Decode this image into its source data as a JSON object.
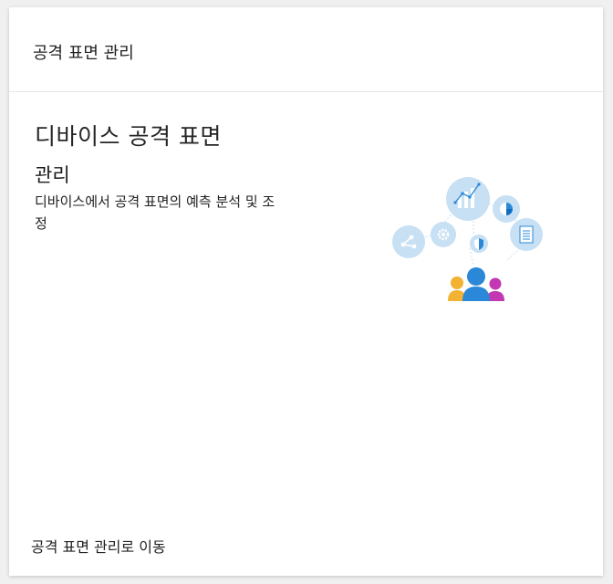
{
  "card": {
    "header_title": "공격 표면 관리",
    "hero_title": "디바이스 공격 표면",
    "hero_subtitle": "관리",
    "description": "디바이스에서 공격 표면의 예측 분석 및 조정",
    "footer_link": "공격 표면 관리로 이동"
  },
  "illustration": {
    "icons": [
      "chart-icon",
      "pie-icon",
      "share-icon",
      "gear-icon",
      "shield-icon",
      "document-icon",
      "people-icon"
    ],
    "colors": {
      "bubble": "#c7e0f4",
      "bubble_icon": "#ffffff",
      "person_center": "#2b88d8",
      "person_left": "#f2b233",
      "person_right": "#c239b3"
    }
  }
}
